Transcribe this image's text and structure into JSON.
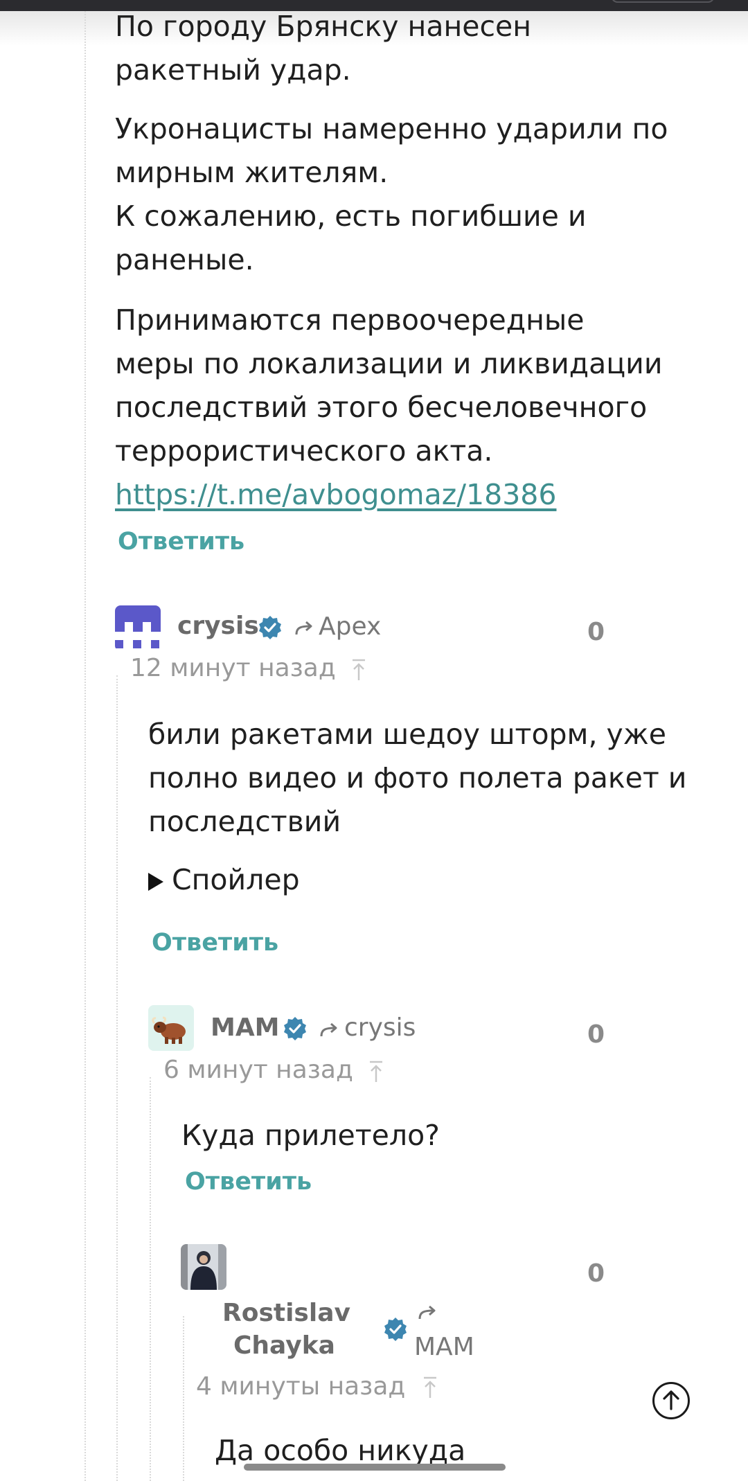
{
  "post": {
    "paragraphs": [
      [
        "По городу Брянску нанесен",
        "ракетный удар."
      ],
      [
        "Укронацисты намеренно ударили по",
        "мирным жителям.",
        "К сожалению, есть погибшие и",
        "раненые."
      ],
      [
        "Принимаются первоочередные",
        "меры по локализации и ликвидации",
        "последствий этого бесчеловечного",
        "террористического акта."
      ]
    ],
    "link": "https://t.me/avbogomaz/18386",
    "reply_label": "Ответить"
  },
  "comments": [
    {
      "author": "crysis",
      "reply_to": "Apex",
      "score": "0",
      "time": "12 минут назад",
      "body": [
        "били ракетами шедоу шторм, уже",
        "полно видео и фото полета ракет и",
        "последствий"
      ],
      "spoiler_label": "Спойлер",
      "reply_label": "Ответить",
      "avatar_icon": "pixel-invader-avatar"
    },
    {
      "author": "MAM",
      "reply_to": "crysis",
      "score": "0",
      "time": "6 минут назад",
      "body": [
        "Куда прилетело?"
      ],
      "reply_label": "Ответить",
      "avatar_icon": "yak-emoji-avatar"
    },
    {
      "author_lines": [
        "Rostislav",
        "Chayka"
      ],
      "reply_to": "MAM",
      "score": "0",
      "time": "4 минуты назад",
      "body": [
        "Да особо никуда"
      ],
      "avatar_icon": "person-photo-avatar"
    }
  ],
  "icons": {
    "verified": "verified-badge-icon",
    "reply_arrow": "reply-arrow-icon",
    "parent": "go-to-parent-icon",
    "scroll_top": "scroll-to-top-icon"
  },
  "colors": {
    "accent": "#4aa3a3",
    "link": "#3f8f8f",
    "verified": "#3d86b0",
    "avatar_crysis": "#5b58c9"
  }
}
